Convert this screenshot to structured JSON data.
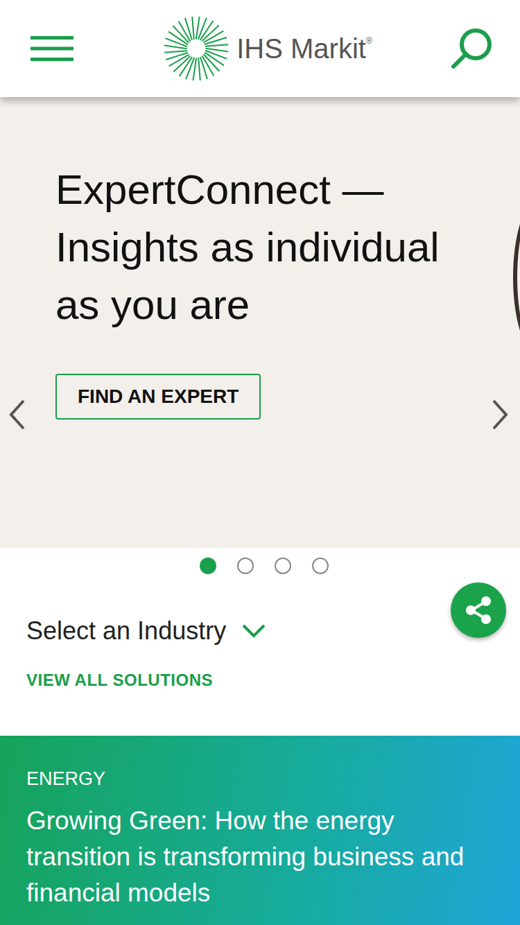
{
  "header": {
    "logo": {
      "name": "IHS Markit",
      "mark": "®"
    }
  },
  "carousel": {
    "title_lines": [
      "ExpertConnect —",
      "Insights as individual",
      "as you are"
    ],
    "button": "FIND AN EXPERT",
    "slides": [
      {
        "selected": true
      },
      {
        "selected": false
      },
      {
        "selected": false
      },
      {
        "selected": false
      }
    ]
  },
  "industry": {
    "label": "Select an Industry",
    "expanded": false
  },
  "view_all": "VIEW ALL SOLUTIONS",
  "feature": {
    "category": "ENERGY",
    "headline": "Growing Green: How the energy transition is transforming business and financial models"
  }
}
